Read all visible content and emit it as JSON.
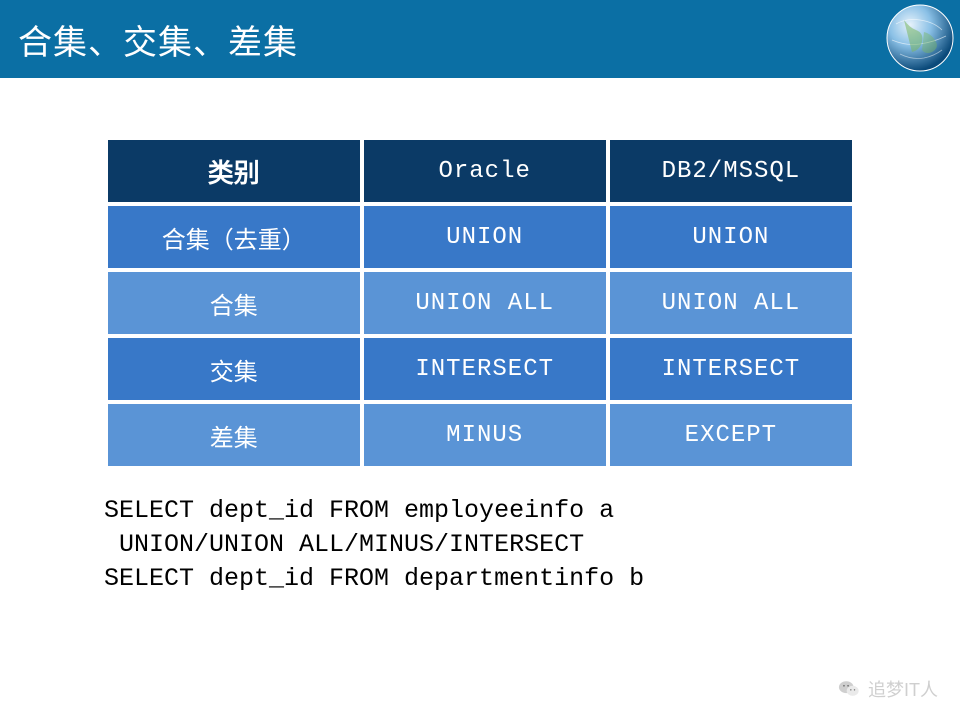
{
  "header": {
    "title": "合集、交集、差集"
  },
  "table": {
    "headers": [
      "类别",
      "Oracle",
      "DB2/MSSQL"
    ],
    "rows": [
      {
        "label": "合集（去重）",
        "oracle": "UNION",
        "db2mssql": "UNION"
      },
      {
        "label": "合集",
        "oracle": "UNION ALL",
        "db2mssql": "UNION ALL"
      },
      {
        "label": "交集",
        "oracle": "INTERSECT",
        "db2mssql": "INTERSECT"
      },
      {
        "label": "差集",
        "oracle": "MINUS",
        "db2mssql": "EXCEPT"
      }
    ]
  },
  "code": {
    "line1": "SELECT dept_id FROM employeeinfo a",
    "line2": " UNION/UNION ALL/MINUS/INTERSECT",
    "line3": "SELECT dept_id FROM departmentinfo b"
  },
  "watermark": {
    "text": "追梦IT人"
  }
}
